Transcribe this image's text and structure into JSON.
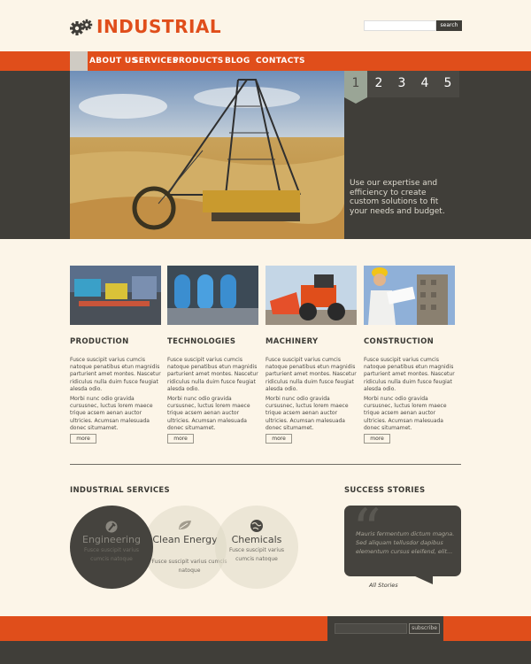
{
  "brand": {
    "name": "INDUSTRIAL",
    "icon": "gears-icon",
    "accent": "#e04e1b",
    "dark": "#403e39"
  },
  "search": {
    "placeholder": "",
    "button_label": "search"
  },
  "nav": {
    "items": [
      "ABOUT US",
      "SERVICES",
      "PRODUCTS",
      "BLOG",
      "CONTACTS"
    ]
  },
  "slider": {
    "pages": [
      "1",
      "2",
      "3",
      "4",
      "5"
    ],
    "active": "1",
    "caption": "Use our expertise and efficiency to create custom solutions to fit your needs and budget."
  },
  "cards": [
    {
      "title": "PRODUCTION",
      "p1": "Fusce suscipit varius cumcis natoque penatibus etun magnidis parturient amet montes. Nascetur ridiculus nulla duim fusce feugiat alesda odio.",
      "p2": "Morbi nunc odio gravida cursusnec, luctus lorem maece trique acsem aenan auctor ultricies. Acumsan malesuada donec situmamet.",
      "more": "more"
    },
    {
      "title": "TECHNOLOGIES",
      "p1": "Fusce suscipit varius cumcis natoque penatibus etun magnidis parturient amet montes. Nascetur ridiculus nulla duim fusce feugiat alesda odio.",
      "p2": "Morbi nunc odio gravida cursusnec, luctus lorem maece trique acsem aenan auctor ultricies. Acumsan malesuada donec situmamet.",
      "more": "more"
    },
    {
      "title": "MACHINERY",
      "p1": "Fusce suscipit varius cumcis natoque penatibus etun magnidis parturient amet montes. Nascetur ridiculus nulla duim fusce feugiat alesda odio.",
      "p2": "Morbi nunc odio gravida cursusnec, luctus lorem maece trique acsem aenan auctor ultricies. Acumsan malesuada donec situmamet.",
      "more": "more"
    },
    {
      "title": "CONSTRUCTION",
      "p1": "Fusce suscipit varius cumcis natoque penatibus etun magnidis parturient amet montes. Nascetur ridiculus nulla duim fusce feugiat alesda odio.",
      "p2": "Morbi nunc odio gravida cursusnec, luctus lorem maece trique acsem aenan auctor ultricies. Acumsan malesuada donec situmamet.",
      "more": "more"
    }
  ],
  "services": {
    "title": "INDUSTRIAL SERVICES",
    "items": [
      {
        "label": "Engineering",
        "text": "Fusce suscipit varius cumcis natoque",
        "icon": "wrench-icon"
      },
      {
        "label": "Clean Energy",
        "text": "Fusce suscipit varius cumcis natoque",
        "icon": "leaf-icon"
      },
      {
        "label": "Chemicals",
        "text": "Fusce suscipit varius cumcis natoque",
        "icon": "globe-icon"
      }
    ]
  },
  "success": {
    "title": "SUCCESS STORIES",
    "quote": "Mauris fermentum dictum magna. Sed aliquam tellusdor dapibus elementum cursus eleifend, elit...",
    "link": "All Stories"
  },
  "footer": {
    "subscribe_placeholder": "",
    "subscribe_label": "subscribe"
  }
}
